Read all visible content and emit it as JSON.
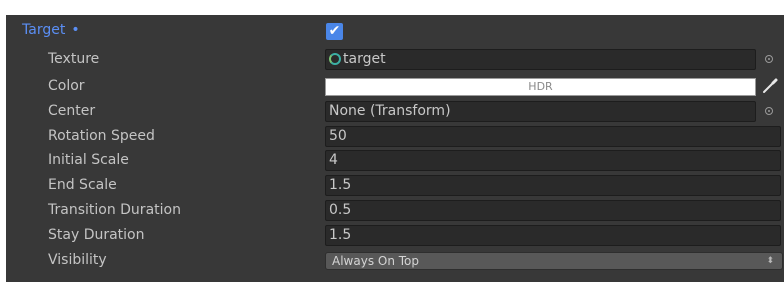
{
  "inspector": {
    "foldout": {
      "label": "Target",
      "modified_marker": "•",
      "enabled": true,
      "check_glyph": "✔"
    },
    "rows": {
      "texture": {
        "label": "Texture",
        "value": "target",
        "icon": "texture-asset-icon"
      },
      "color": {
        "label": "Color",
        "badge": "HDR",
        "swatch_color": "#ffffff"
      },
      "center": {
        "label": "Center",
        "value": "None (Transform)"
      },
      "rotation_speed": {
        "label": "Rotation Speed",
        "value": "50"
      },
      "initial_scale": {
        "label": "Initial Scale",
        "value": "4"
      },
      "end_scale": {
        "label": "End Scale",
        "value": "1.5"
      },
      "transition_duration": {
        "label": "Transition Duration",
        "value": "0.5"
      },
      "stay_duration": {
        "label": "Stay Duration",
        "value": "1.5"
      },
      "visibility": {
        "label": "Visibility",
        "value": "Always On Top",
        "arrow": "⬍"
      }
    }
  },
  "colors": {
    "panel": "#383838",
    "label_text": "#c4c4c4",
    "foldout_text": "#5b8ff5",
    "checkbox": "#4a86e8",
    "field_bg": "#2a2a2a"
  }
}
